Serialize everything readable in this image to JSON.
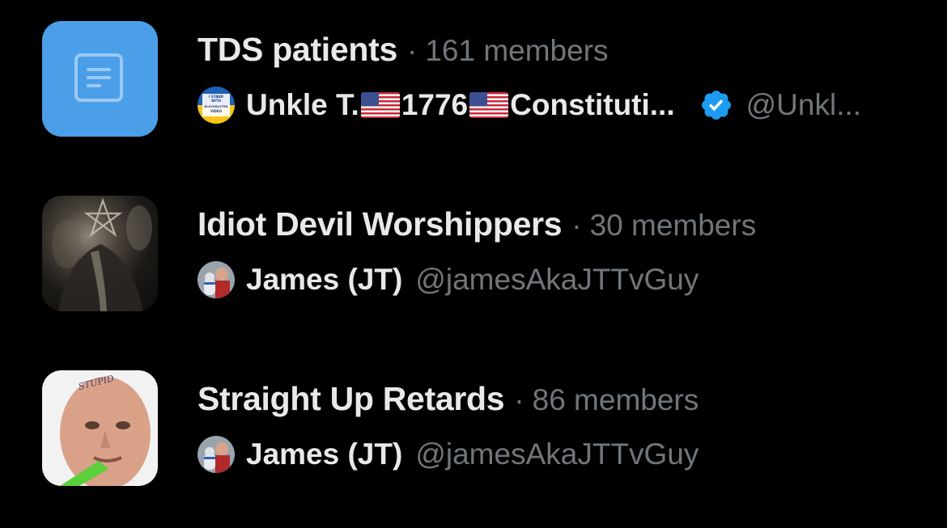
{
  "communities": [
    {
      "title": "TDS patients",
      "separator": "·",
      "members": "161 members",
      "thumbnail": "list-document-icon",
      "owner": {
        "avatar_text": "I STAND WITH BLOCKBUSTER VIDEO",
        "name_parts": [
          "Unkle T. ",
          "1776",
          " Constituti..."
        ],
        "verified": true,
        "handle": "@Unkl..."
      }
    },
    {
      "title": "Idiot Devil Worshippers",
      "separator": "·",
      "members": "30 members",
      "thumbnail": "pentagram-image",
      "owner": {
        "name": "James (JT)",
        "handle": "@jamesAkaJTTvGuy"
      }
    },
    {
      "title": "Straight Up Retards",
      "separator": "·",
      "members": "86 members",
      "thumbnail": "face-photo",
      "thumbnail_text": "STUPID",
      "owner": {
        "name": "James (JT)",
        "handle": "@jamesAkaJTTvGuy"
      }
    }
  ],
  "colors": {
    "background": "#000000",
    "primary_text": "#e7e9ea",
    "secondary_text": "#71767b",
    "thumbnail_blue": "#4a9fe8",
    "verified_blue": "#1d9bf0"
  }
}
